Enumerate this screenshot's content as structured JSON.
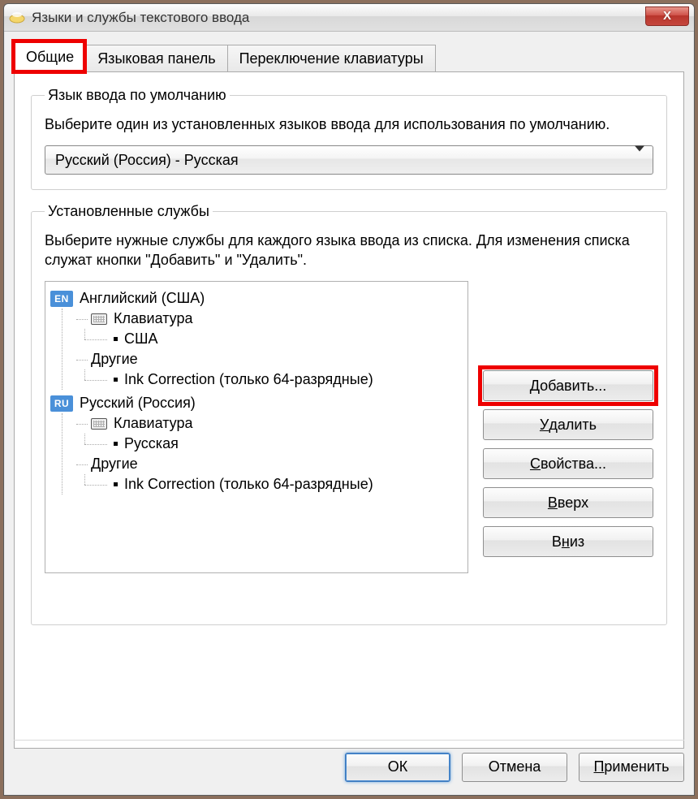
{
  "window": {
    "title": "Языки и службы текстового ввода"
  },
  "tabs": {
    "general": "Общие",
    "language_bar": "Языковая панель",
    "switch_keyboard": "Переключение клавиатуры"
  },
  "default_lang": {
    "legend": "Язык ввода по умолчанию",
    "desc": "Выберите один из установленных языков ввода для использования по умолчанию.",
    "selected": "Русский (Россия) - Русская"
  },
  "installed": {
    "legend": "Установленные службы",
    "desc": "Выберите нужные службы для каждого языка ввода из списка. Для изменения списка служат кнопки \"Добавить\" и \"Удалить\".",
    "langs": [
      {
        "badge": "EN",
        "name": "Английский (США)",
        "categories": [
          {
            "type": "keyboard",
            "label": "Клавиатура",
            "items": [
              "США"
            ]
          },
          {
            "type": "other",
            "label": "Другие",
            "items": [
              "Ink Correction (только 64-разрядные)"
            ]
          }
        ]
      },
      {
        "badge": "RU",
        "name": "Русский (Россия)",
        "categories": [
          {
            "type": "keyboard",
            "label": "Клавиатура",
            "items": [
              "Русская"
            ]
          },
          {
            "type": "other",
            "label": "Другие",
            "items": [
              "Ink Correction (только 64-разрядные)"
            ]
          }
        ]
      }
    ]
  },
  "side_buttons": {
    "add": "Добавить...",
    "remove": "Удалить",
    "properties": "Свойства...",
    "up": "Вверх",
    "down": "Вниз"
  },
  "bottom": {
    "ok": "ОК",
    "cancel": "Отмена",
    "apply": "Применить"
  }
}
